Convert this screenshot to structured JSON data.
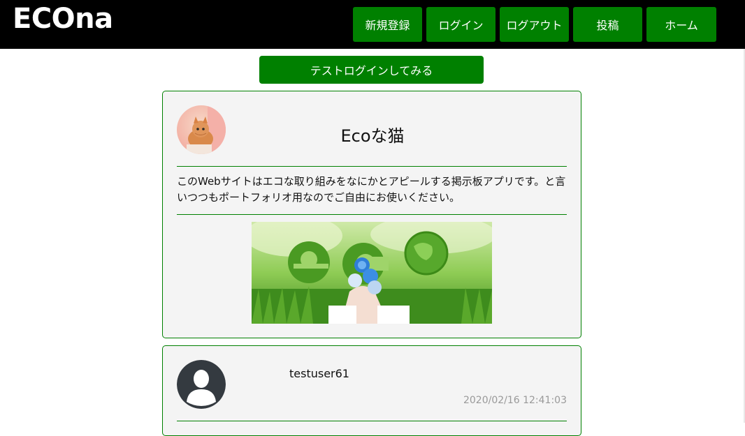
{
  "header": {
    "logo": "ECOna",
    "nav": [
      {
        "label": "新規登録"
      },
      {
        "label": "ログイン"
      },
      {
        "label": "ログアウト"
      },
      {
        "label": "投稿"
      },
      {
        "label": "ホーム"
      }
    ],
    "background": "#000000",
    "accent": "#008000"
  },
  "main": {
    "test_login_label": "テストログインしてみる",
    "posts": [
      {
        "title": "Ecoな猫",
        "body": "このWebサイトはエコな取り組みをなにかとアピールする掲示板アプリです。と言いつつもポートフォリオ用なのでご自由にお使いください。",
        "avatar_icon": "cat-photo-avatar",
        "image_icon": "eco-grass-image"
      },
      {
        "username": "testuser61",
        "timestamp": "2020/02/16 12:41:03",
        "avatar_icon": "user-silhouette-icon"
      }
    ]
  }
}
